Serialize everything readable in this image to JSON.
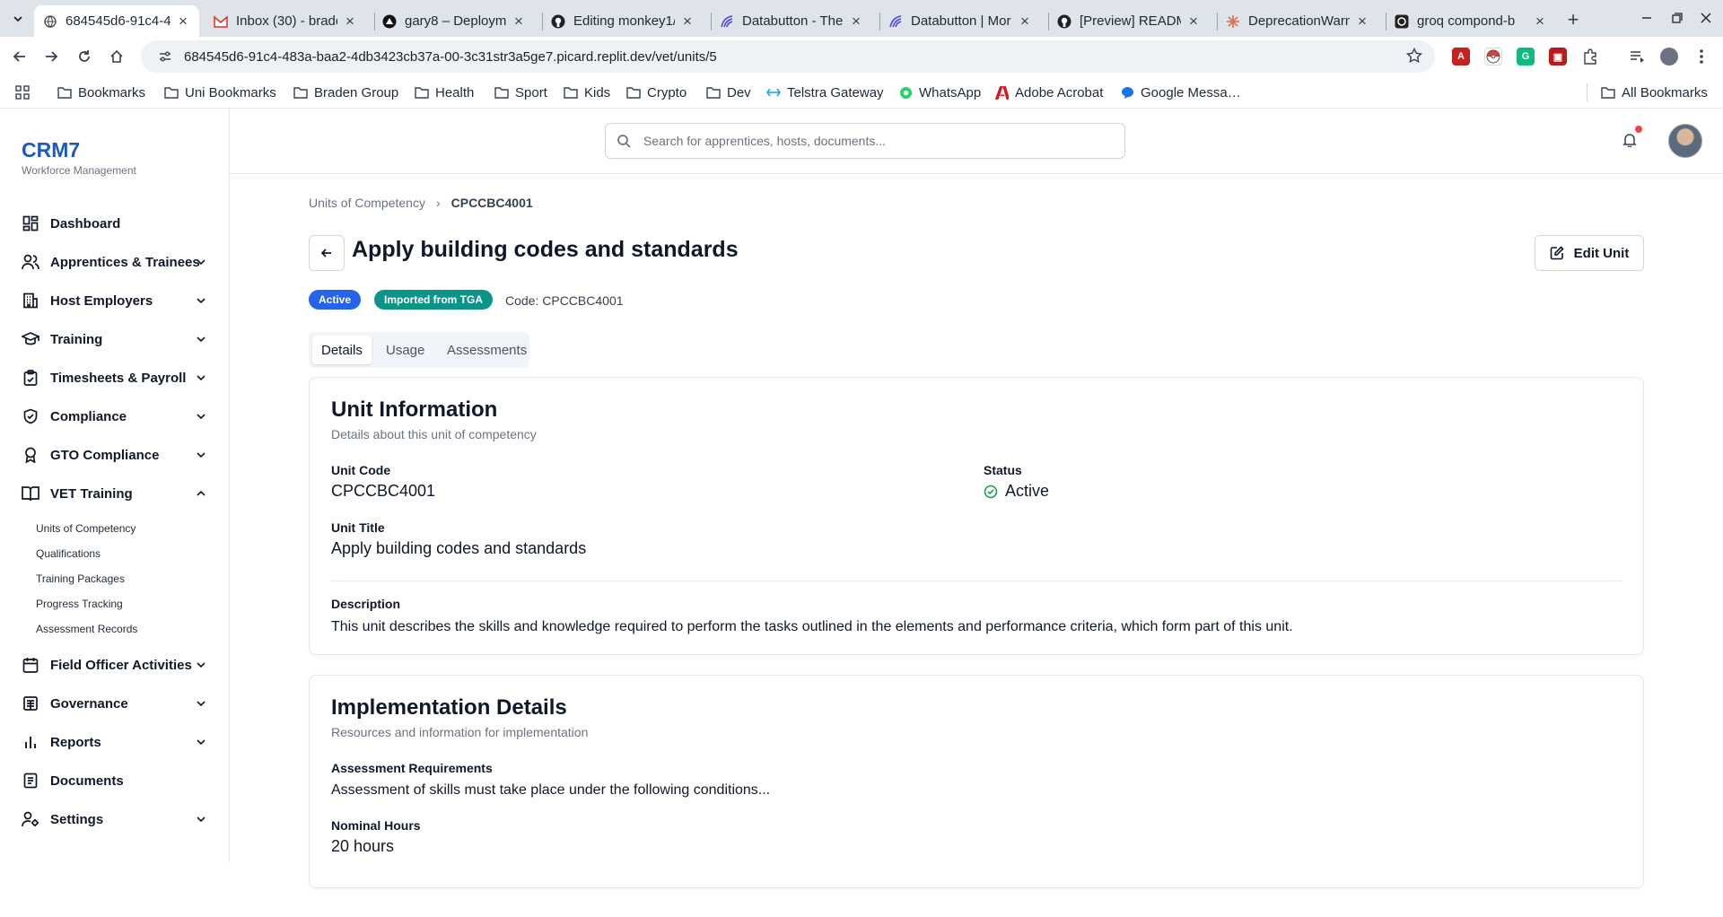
{
  "browser": {
    "tabs": [
      {
        "title": "684545d6-91c4-4",
        "active": true
      },
      {
        "title": "Inbox (30) - brade"
      },
      {
        "title": "gary8 – Deployme"
      },
      {
        "title": "Editing monkey1/"
      },
      {
        "title": "Databutton - The"
      },
      {
        "title": "Databutton | Mor"
      },
      {
        "title": "[Preview] READM"
      },
      {
        "title": "DeprecationWarn"
      },
      {
        "title": "groq compond-b"
      }
    ],
    "url": "684545d6-91c4-483a-baa2-4db3423cb37a-00-3c31str3a5ge7.picard.replit.dev/vet/units/5",
    "bookmarks": [
      "Bookmarks",
      "Uni Bookmarks",
      "Braden Group",
      "Health",
      "Sport",
      "Kids",
      "Crypto",
      "Dev",
      "Telstra Gateway",
      "WhatsApp",
      "Adobe Acrobat",
      "Google Messa…"
    ],
    "all_bookmarks": "All Bookmarks"
  },
  "app": {
    "brand": "CRM7",
    "brand_sub": "Workforce Management",
    "search_placeholder": "Search for apprentices, hosts, documents...",
    "nav": [
      {
        "label": "Dashboard",
        "icon": "dashboard-icon"
      },
      {
        "label": "Apprentices & Trainees",
        "icon": "users-icon"
      },
      {
        "label": "Host Employers",
        "icon": "building-icon"
      },
      {
        "label": "Training",
        "icon": "graduation-cap-icon"
      },
      {
        "label": "Timesheets & Payroll",
        "icon": "clipboard-check-icon"
      },
      {
        "label": "Compliance",
        "icon": "shield-check-icon"
      },
      {
        "label": "GTO Compliance",
        "icon": "award-icon"
      },
      {
        "label": "VET Training",
        "icon": "book-open-icon"
      },
      {
        "label": "Field Officer Activities",
        "icon": "calendar-icon"
      },
      {
        "label": "Governance",
        "icon": "landmark-icon"
      },
      {
        "label": "Reports",
        "icon": "bar-chart-icon"
      },
      {
        "label": "Documents",
        "icon": "file-icon"
      },
      {
        "label": "Settings",
        "icon": "user-cog-icon"
      }
    ],
    "vet_sub": [
      "Units of Competency",
      "Qualifications",
      "Training Packages",
      "Progress Tracking",
      "Assessment Records"
    ]
  },
  "page": {
    "breadcrumb_parent": "Units of Competency",
    "breadcrumb_current": "CPCCBC4001",
    "title": "Apply building codes and standards",
    "edit_label": "Edit Unit",
    "badge_active": "Active",
    "badge_tga": "Imported from TGA",
    "code_prefix": "Code:",
    "code_value": "CPCCBC4001",
    "tabs": [
      "Details",
      "Usage",
      "Assessments"
    ],
    "unit_info": {
      "title": "Unit Information",
      "subtitle": "Details about this unit of competency",
      "code_label": "Unit Code",
      "code_value": "CPCCBC4001",
      "status_label": "Status",
      "status_value": "Active",
      "title_label": "Unit Title",
      "title_value": "Apply building codes and standards",
      "desc_label": "Description",
      "desc_value": "This unit describes the skills and knowledge required to perform the tasks outlined in the elements and performance criteria, which form part of this unit."
    },
    "impl": {
      "title": "Implementation Details",
      "subtitle": "Resources and information for implementation",
      "assess_label": "Assessment Requirements",
      "assess_value": "Assessment of skills must take place under the following conditions...",
      "hours_label": "Nominal Hours",
      "hours_value": "20 hours"
    }
  },
  "colors": {
    "brand": "#1e5bb8",
    "badge_active": "#2563eb",
    "badge_tga": "#0d9488",
    "status_ok": "#16a34a",
    "notification": "#ef4444"
  }
}
